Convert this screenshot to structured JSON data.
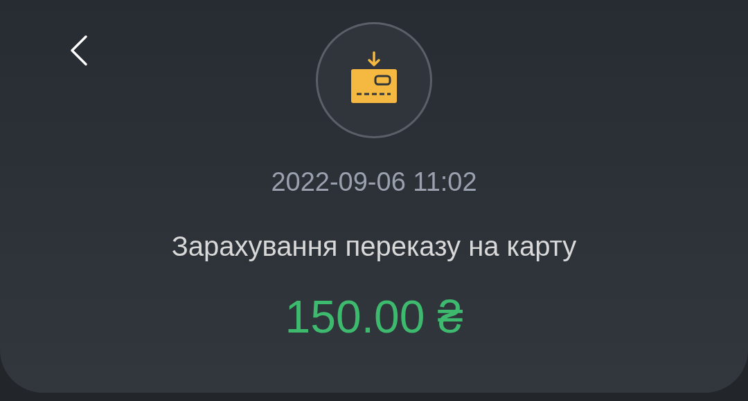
{
  "transaction": {
    "incoming": true,
    "date": "2022-09-06 11:02",
    "title": "Зарахування переказу на карту",
    "amount": "150.00 ₴"
  }
}
